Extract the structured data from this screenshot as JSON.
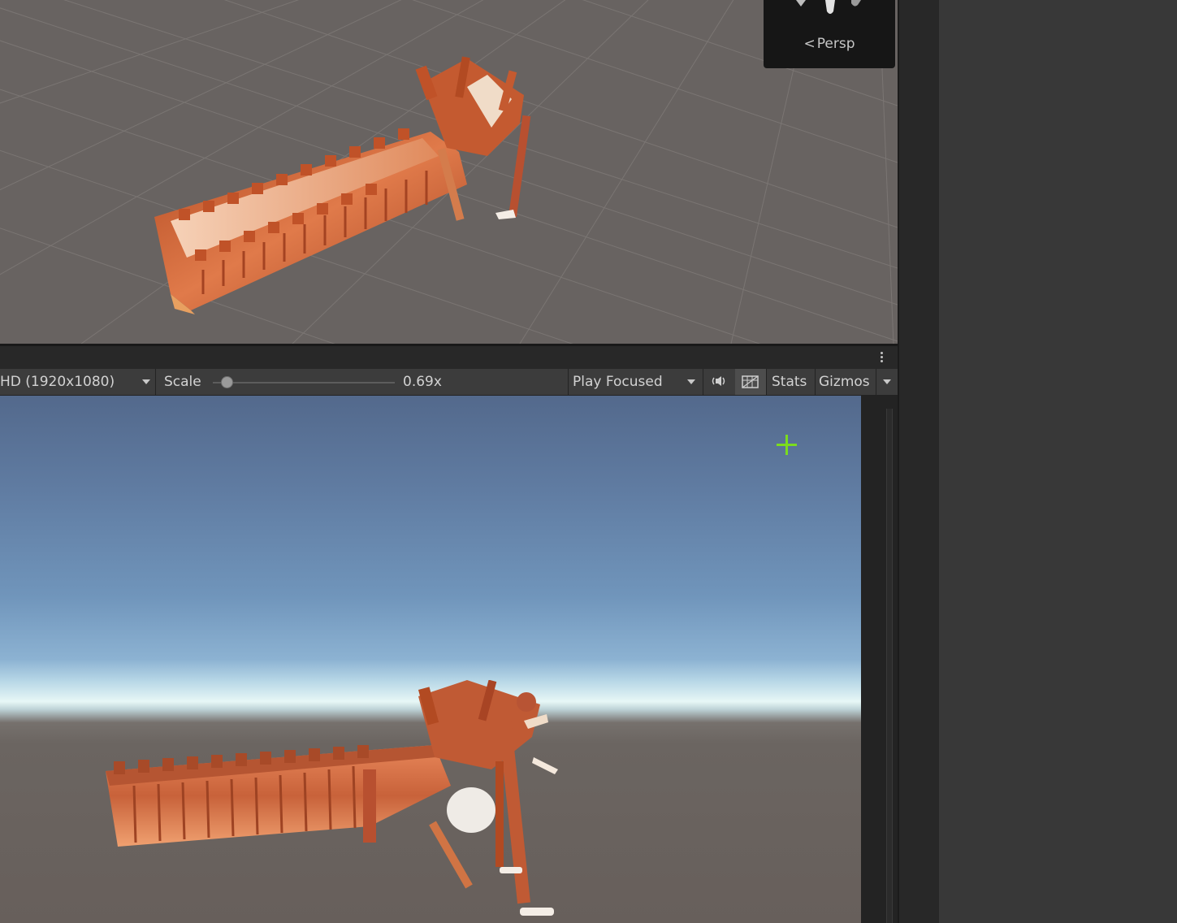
{
  "scene_view": {
    "camera_mode": "Persp",
    "gizmo_icon": "orientation-gizmo-icon",
    "back_icon": "chevron-left-icon"
  },
  "game_view": {
    "toolbar": {
      "resolution": "HD (1920x1080)",
      "scale_label": "Scale",
      "scale_value": "0.69x",
      "scale_level": 0.05,
      "play_mode": "Play Focused",
      "audio_icon": "speaker-icon",
      "aspect_icon": "aspect-grid-icon",
      "stats_label": "Stats",
      "gizmos_label": "Gizmos"
    },
    "crosshair_color": "#7bdc1d",
    "sky_top_color": "#53698c",
    "horizon_color": "#e7f7f6",
    "ground_color": "#675f5b"
  },
  "colors": {
    "scene_ground": "#686361",
    "model_primary": "#c8623a",
    "model_highlight": "#f0b088",
    "toolbar_bg": "#3c3c3c",
    "panel_dark": "#161616"
  }
}
